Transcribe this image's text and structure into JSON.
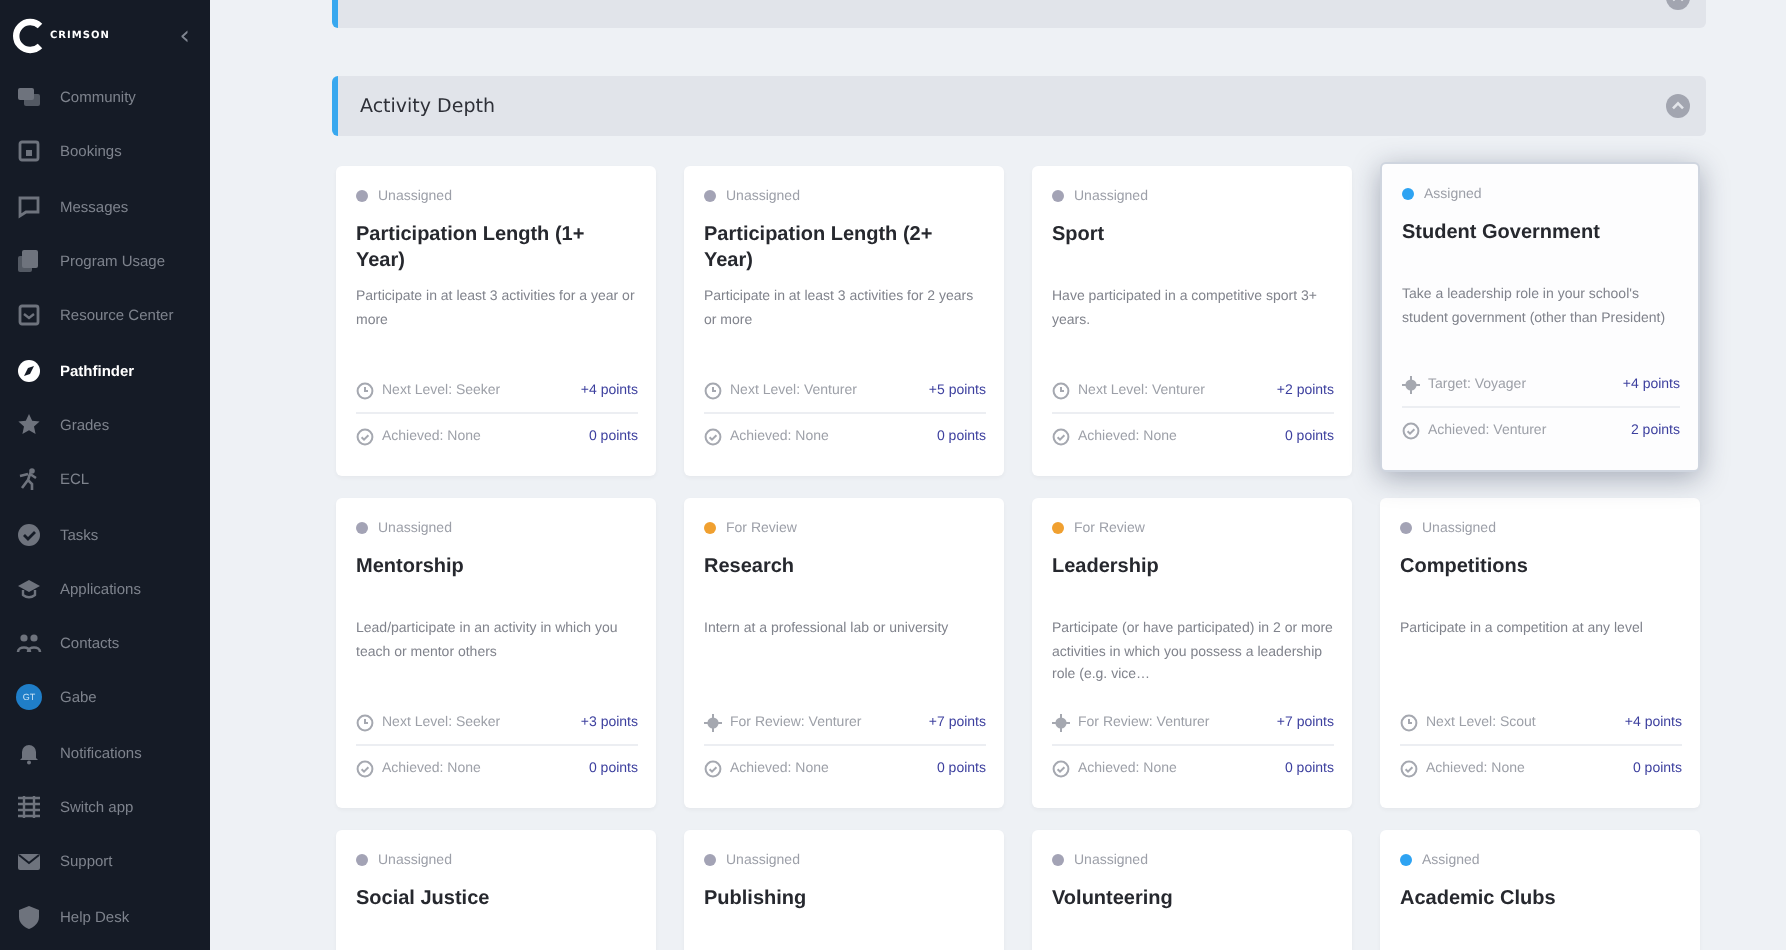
{
  "sidebar": {
    "logo": "CRIMSON",
    "collapse": "‹",
    "items": [
      {
        "label": "Community",
        "kind": "link",
        "selected": false
      },
      {
        "label": "Bookings",
        "kind": "link",
        "selected": false
      },
      {
        "label": "Messages",
        "kind": "link",
        "selected": false
      },
      {
        "label": "Program Usage",
        "kind": "link",
        "selected": false
      },
      {
        "label": "Resource Center",
        "kind": "link",
        "selected": false
      },
      {
        "label": "Pathfinder",
        "kind": "link",
        "selected": true
      },
      {
        "label": "Grades",
        "kind": "link",
        "selected": false
      },
      {
        "label": "ECL",
        "kind": "link",
        "selected": false
      },
      {
        "label": "Tasks",
        "kind": "link",
        "selected": false
      },
      {
        "label": "Applications",
        "kind": "link",
        "selected": false
      },
      {
        "label": "Contacts",
        "kind": "link",
        "selected": false
      },
      {
        "label": "Gabe",
        "kind": "avatar",
        "initials": "GT",
        "selected": false
      },
      {
        "label": "Notifications",
        "kind": "link",
        "selected": false
      },
      {
        "label": "Switch app",
        "kind": "link",
        "selected": false
      },
      {
        "label": "Support",
        "kind": "link",
        "selected": false
      },
      {
        "label": "Help Desk",
        "kind": "link",
        "selected": false
      }
    ]
  },
  "sections": [
    {
      "expanded": true
    },
    {
      "title": "Activity Depth",
      "expanded": true,
      "cards": [
        {
          "status": "Unassigned",
          "color": "#a3a3b5",
          "title": "Participation Length (1+ Year)",
          "description": "Participate in at least 3 activities for a year or more",
          "selected": false,
          "lines": [
            {
              "kind": "next",
              "label": "Next Level: Seeker",
              "points": "+4 points"
            },
            {
              "kind": "achieved",
              "label": "Achieved: None",
              "points": "0 points"
            }
          ]
        },
        {
          "status": "Unassigned",
          "color": "#a3a3b5",
          "title": "Participation Length (2+ Year)",
          "description": "Participate in at least 3 activities for 2 years or more",
          "selected": false,
          "lines": [
            {
              "kind": "next",
              "label": "Next Level: Venturer",
              "points": "+5 points"
            },
            {
              "kind": "achieved",
              "label": "Achieved: None",
              "points": "0 points"
            }
          ]
        },
        {
          "status": "Unassigned",
          "color": "#a3a3b5",
          "title": "Sport",
          "description": "Have participated in a competitive sport 3+ years.",
          "selected": false,
          "lines": [
            {
              "kind": "next",
              "label": "Next Level: Venturer",
              "points": "+2 points"
            },
            {
              "kind": "achieved",
              "label": "Achieved: None",
              "points": "0 points"
            }
          ]
        },
        {
          "status": "Assigned",
          "color": "#2ea3f2",
          "title": "Student Government",
          "description": "Take a leadership role in your school's student government (other than President)",
          "selected": true,
          "lines": [
            {
              "kind": "target",
              "label": "Target: Voyager",
              "points": "+4 points"
            },
            {
              "kind": "achieved",
              "label": "Achieved: Venturer",
              "points": "2 points"
            }
          ]
        },
        {
          "status": "Unassigned",
          "color": "#a3a3b5",
          "title": "Mentorship",
          "description": "Lead/participate in an activity in which you teach or mentor others",
          "selected": false,
          "lines": [
            {
              "kind": "next",
              "label": "Next Level: Seeker",
              "points": "+3 points"
            },
            {
              "kind": "achieved",
              "label": "Achieved: None",
              "points": "0 points"
            }
          ]
        },
        {
          "status": "For Review",
          "color": "#f0a030",
          "title": "Research",
          "description": "Intern at a professional lab or university",
          "selected": false,
          "lines": [
            {
              "kind": "target",
              "label": "For Review: Venturer",
              "points": "+7 points"
            },
            {
              "kind": "achieved",
              "label": "Achieved: None",
              "points": "0 points"
            }
          ]
        },
        {
          "status": "For Review",
          "color": "#f0a030",
          "title": "Leadership",
          "description": "Participate (or have participated) in 2 or more activities in which you possess a leadership role (e.g. vice…",
          "selected": false,
          "lines": [
            {
              "kind": "target",
              "label": "For Review: Venturer",
              "points": "+7 points"
            },
            {
              "kind": "achieved",
              "label": "Achieved: None",
              "points": "0 points"
            }
          ]
        },
        {
          "status": "Unassigned",
          "color": "#a3a3b5",
          "title": "Competitions",
          "description": "Participate in a competition at any level",
          "selected": false,
          "lines": [
            {
              "kind": "next",
              "label": "Next Level: Scout",
              "points": "+4 points"
            },
            {
              "kind": "achieved",
              "label": "Achieved: None",
              "points": "0 points"
            }
          ]
        },
        {
          "status": "Unassigned",
          "color": "#a3a3b5",
          "title": "Social Justice",
          "selected": false
        },
        {
          "status": "Unassigned",
          "color": "#a3a3b5",
          "title": "Publishing",
          "selected": false
        },
        {
          "status": "Unassigned",
          "color": "#a3a3b5",
          "title": "Volunteering",
          "selected": false
        },
        {
          "status": "Assigned",
          "color": "#2ea3f2",
          "title": "Academic Clubs",
          "selected": false
        }
      ]
    }
  ]
}
